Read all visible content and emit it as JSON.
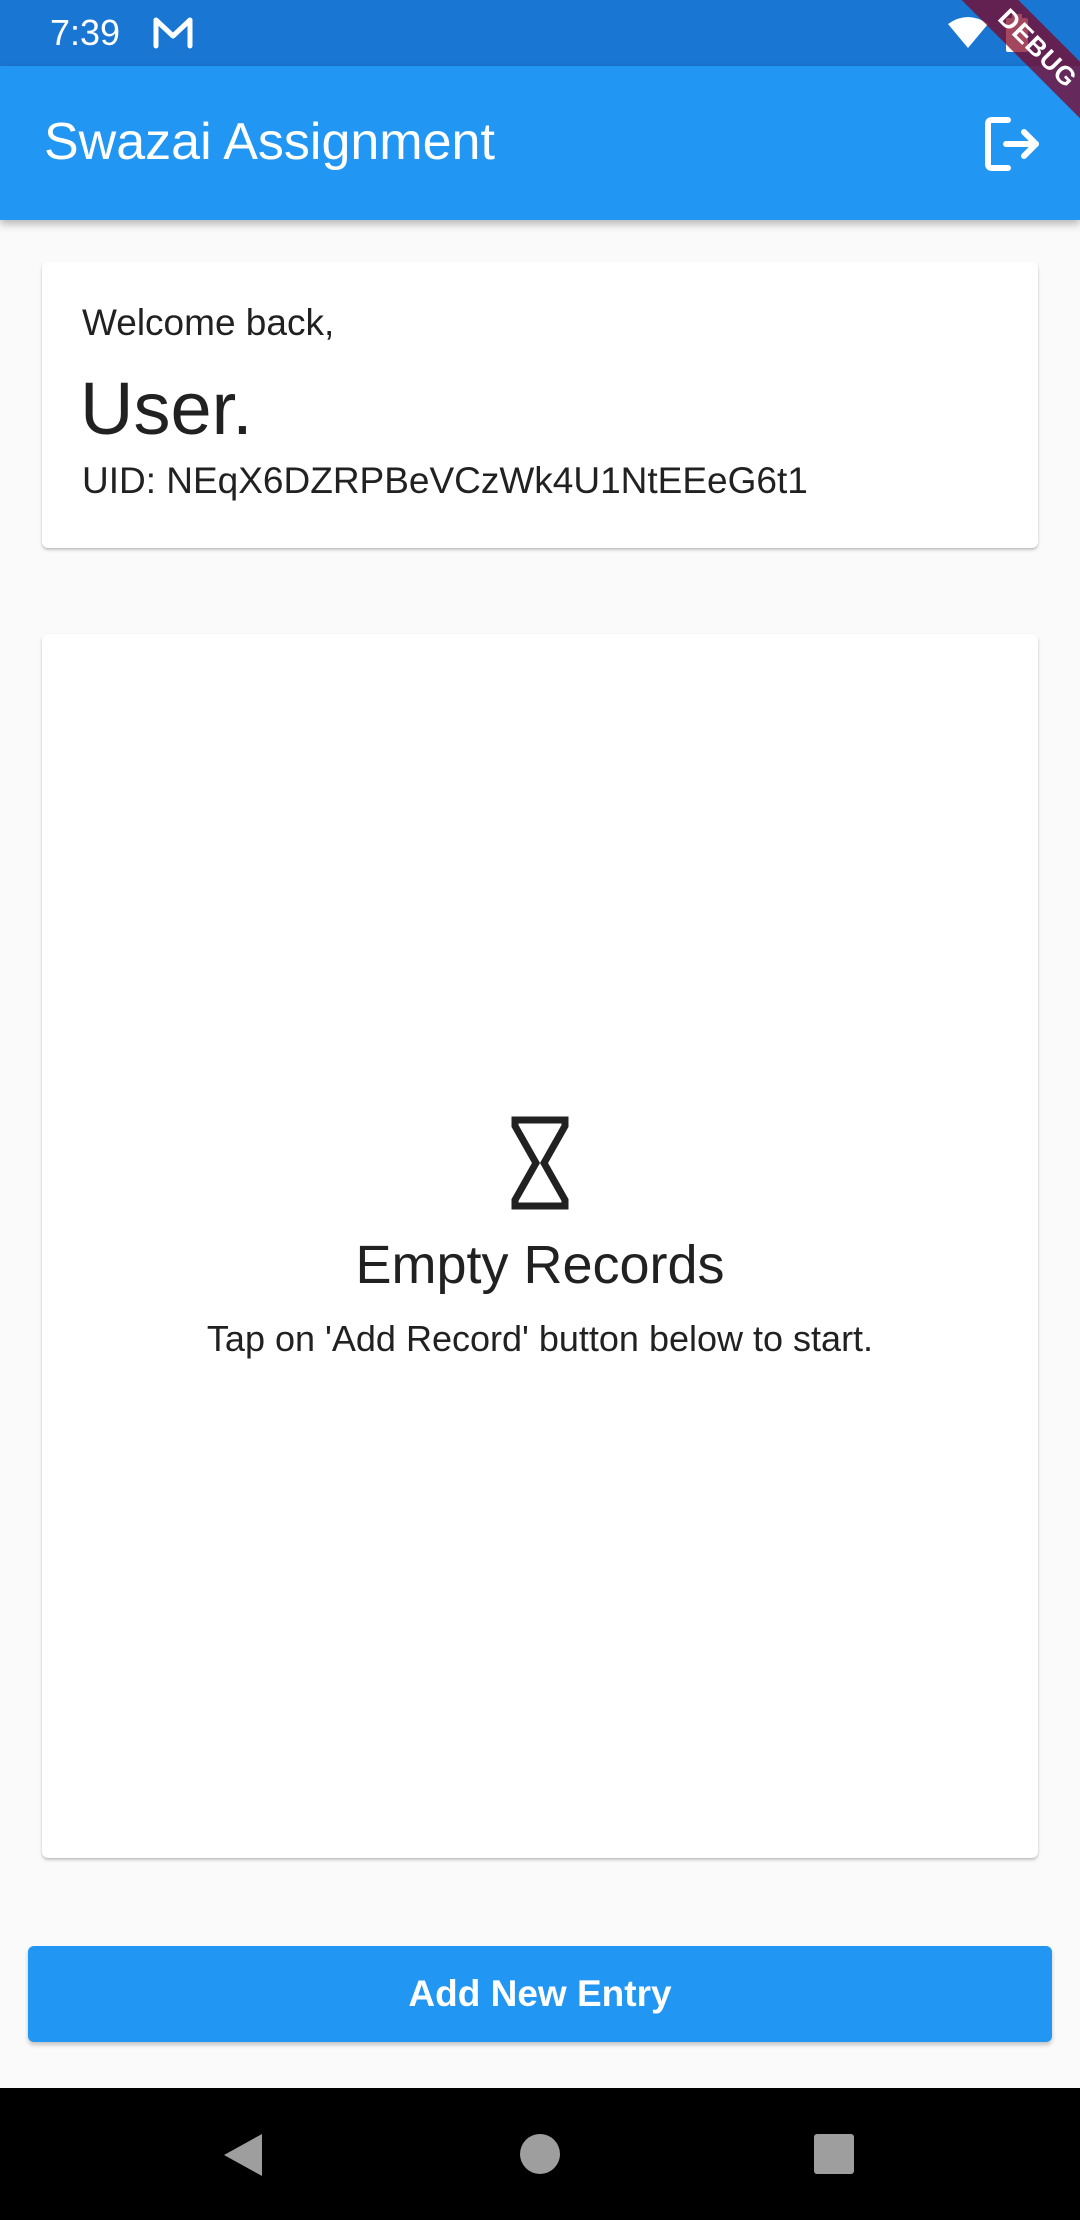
{
  "status_bar": {
    "time": "7:39",
    "icons": [
      "mail-icon",
      "wifi-icon",
      "battery-icon"
    ]
  },
  "debug_banner": "DEBUG",
  "app_bar": {
    "title": "Swazai Assignment",
    "action_icon": "logout-icon"
  },
  "welcome_card": {
    "greeting": "Welcome back,",
    "name": "User.",
    "uid": "UID: NEqX6DZRPBeVCzWk4U1NtEEeG6t1"
  },
  "records": {
    "icon": "hourglass-icon",
    "empty_title": "Empty Records",
    "empty_message": "Tap on 'Add Record' button below to start."
  },
  "add_button": {
    "label": "Add New Entry"
  },
  "nav_bar": {
    "icons": [
      "back-icon",
      "home-icon",
      "recents-icon"
    ]
  },
  "colors": {
    "status_bar": "#1976d2",
    "app_bar": "#2196f3",
    "primary_button": "#2196f3",
    "background": "#fafafa",
    "debug_banner": "#800020"
  }
}
